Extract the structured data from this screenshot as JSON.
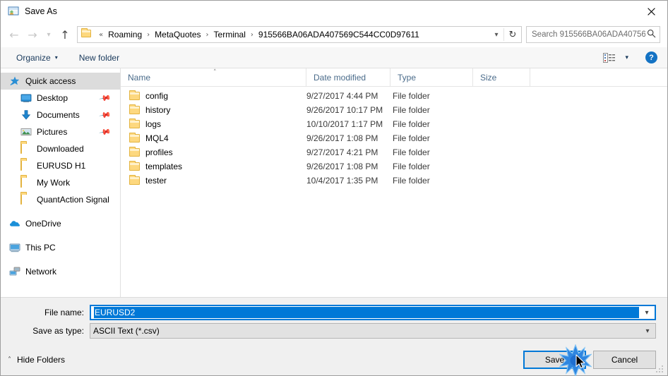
{
  "window": {
    "title": "Save As",
    "title_icon": "save-as-icon",
    "close_icon": "close-icon"
  },
  "nav": {
    "back_icon": "back-arrow-icon",
    "forward_icon": "forward-arrow-icon",
    "recent_icon": "recent-locations-chevron-icon",
    "up_icon": "up-arrow-icon",
    "address_folder_icon": "folder-icon",
    "overflow": "«",
    "breadcrumbs": [
      "Roaming",
      "MetaQuotes",
      "Terminal",
      "915566BA06ADA407569C544CC0D97611"
    ],
    "separator": "›",
    "dropdown_icon": "chevron-down-icon",
    "refresh_icon": "refresh-icon"
  },
  "search": {
    "placeholder": "Search 915566BA06ADA40756...",
    "value": "",
    "icon": "search-icon"
  },
  "commandbar": {
    "organize_label": "Organize",
    "organize_caret": "▾",
    "new_folder_label": "New folder",
    "view_icon": "details-view-icon",
    "view_caret": "▾",
    "help_label": "?",
    "help_icon": "help-icon"
  },
  "sidebar": {
    "items": [
      {
        "label": "Quick access",
        "icon": "quick-access-star-icon",
        "selected": true,
        "indent": false,
        "pinned": false
      },
      {
        "label": "Desktop",
        "icon": "desktop-icon",
        "selected": false,
        "indent": true,
        "pinned": true
      },
      {
        "label": "Documents",
        "icon": "documents-download-icon",
        "selected": false,
        "indent": true,
        "pinned": true
      },
      {
        "label": "Pictures",
        "icon": "pictures-icon",
        "selected": false,
        "indent": true,
        "pinned": true
      },
      {
        "label": "Downloaded",
        "icon": "folder-icon",
        "selected": false,
        "indent": true,
        "pinned": false
      },
      {
        "label": "EURUSD H1",
        "icon": "folder-icon",
        "selected": false,
        "indent": true,
        "pinned": false
      },
      {
        "label": "My Work",
        "icon": "folder-icon",
        "selected": false,
        "indent": true,
        "pinned": false
      },
      {
        "label": "QuantAction Signal",
        "icon": "folder-icon",
        "selected": false,
        "indent": true,
        "pinned": false
      },
      {
        "label": "OneDrive",
        "icon": "onedrive-cloud-icon",
        "selected": false,
        "indent": false,
        "pinned": false,
        "gap_before": true
      },
      {
        "label": "This PC",
        "icon": "this-pc-icon",
        "selected": false,
        "indent": false,
        "pinned": false,
        "gap_before": true
      },
      {
        "label": "Network",
        "icon": "network-icon",
        "selected": false,
        "indent": false,
        "pinned": false,
        "gap_before": true
      }
    ]
  },
  "filelist": {
    "columns": [
      "Name",
      "Date modified",
      "Type",
      "Size"
    ],
    "sort_column": "Name",
    "sort_caret": "˄",
    "rows": [
      {
        "name": "config",
        "date": "9/27/2017 4:44 PM",
        "type": "File folder",
        "size": "",
        "icon": "folder-icon"
      },
      {
        "name": "history",
        "date": "9/26/2017 10:17 PM",
        "type": "File folder",
        "size": "",
        "icon": "folder-icon"
      },
      {
        "name": "logs",
        "date": "10/10/2017 1:17 PM",
        "type": "File folder",
        "size": "",
        "icon": "folder-icon"
      },
      {
        "name": "MQL4",
        "date": "9/26/2017 1:08 PM",
        "type": "File folder",
        "size": "",
        "icon": "folder-icon"
      },
      {
        "name": "profiles",
        "date": "9/27/2017 4:21 PM",
        "type": "File folder",
        "size": "",
        "icon": "folder-icon"
      },
      {
        "name": "templates",
        "date": "9/26/2017 1:08 PM",
        "type": "File folder",
        "size": "",
        "icon": "folder-icon"
      },
      {
        "name": "tester",
        "date": "10/4/2017 1:35 PM",
        "type": "File folder",
        "size": "",
        "icon": "folder-icon"
      }
    ]
  },
  "form": {
    "filename_label": "File name:",
    "filename_value": "EURUSD2",
    "filetype_label": "Save as type:",
    "filetype_value": "ASCII Text (*.csv)",
    "caret_icon": "chevron-down-icon"
  },
  "footer": {
    "hide_folders_label": "Hide Folders",
    "hide_folders_caret": "˄",
    "save_label": "Save",
    "cancel_label": "Cancel",
    "grip_icon": "resize-grip-icon"
  },
  "overlay": {
    "click_burst_icon": "click-burst-indicator",
    "cursor_icon": "mouse-pointer-icon",
    "accent_color": "#0078d7",
    "burst_color": "#1f7fe0"
  }
}
